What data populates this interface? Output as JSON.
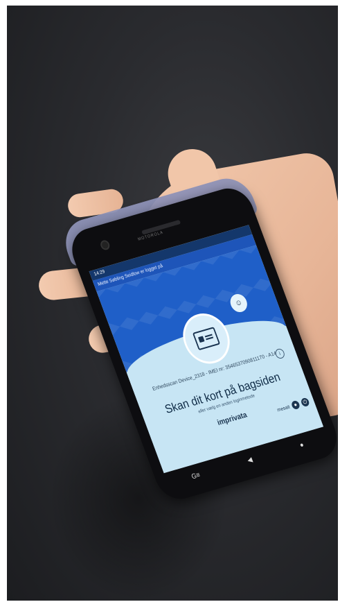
{
  "status_bar": {
    "time": "14:29"
  },
  "notification": {
    "text": "Mette Søbling Seidlow er logget på"
  },
  "screen": {
    "device_line": "Enhedsscan Device_2318 - IMEI nr: 3546537090811170 - A14",
    "main_text": "Skan dit kort på bagsiden",
    "sub_text": "eller vælg en anden loginmetode",
    "brand": "imprivata",
    "bottom_right_label": "mesait"
  },
  "phone": {
    "top_brand": "MOTOROLA"
  },
  "navbar": {
    "back": "◀",
    "home": "●",
    "left_label": "G≡"
  },
  "colors": {
    "banner": "#1f5fc8",
    "screen_bg": "#c7e5f4",
    "case": "#8f93b8"
  },
  "icons": [
    "card-icon",
    "badge-icon",
    "info-icon",
    "user-icon",
    "power-icon"
  ]
}
